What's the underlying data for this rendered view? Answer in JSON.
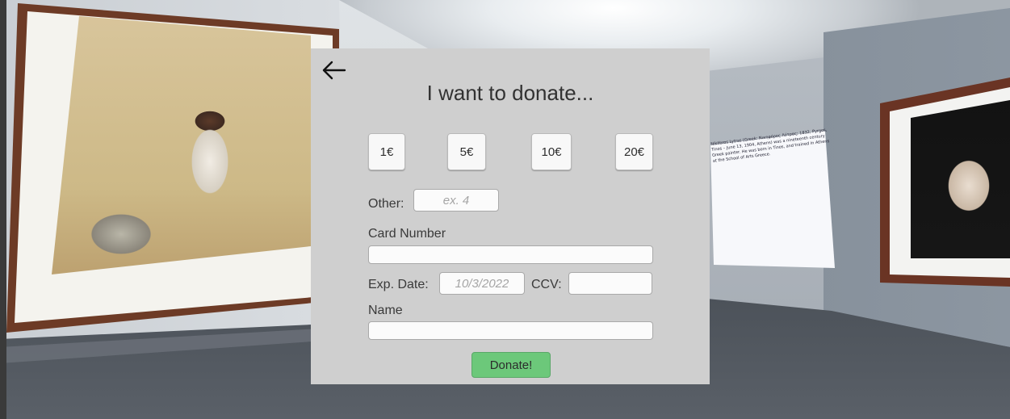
{
  "scene": {
    "placard_text": "Nikiforos Lytras (Greek: Νικηφόρος Λύτρας; 1832, Pyrgos, Tinos – June 13, 1904, Athens) was a nineteenth century Greek painter. He was born in Tinos, and trained in Athens at the School of Arts Greece."
  },
  "donation": {
    "back_icon": "arrow-left-icon",
    "title": "I want to donate...",
    "amounts": [
      "1€",
      "5€",
      "10€",
      "20€"
    ],
    "other_label": "Other:",
    "other_placeholder": "ex. 4",
    "card_number_label": "Card Number",
    "card_number_value": "",
    "exp_date_label": "Exp. Date:",
    "exp_date_placeholder": "10/3/2022",
    "ccv_label": "CCV:",
    "ccv_value": "",
    "name_label": "Name",
    "name_value": "",
    "donate_label": "Donate!"
  },
  "colors": {
    "panel": "#cfcfcf",
    "donate_button": "#6cc87a"
  }
}
